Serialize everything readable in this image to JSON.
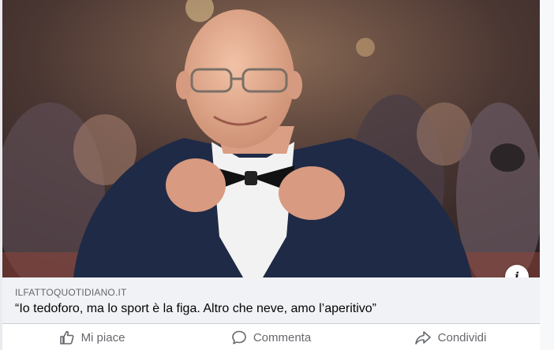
{
  "post": {
    "source_domain": "ILFATTOQUOTIDIANO.IT",
    "headline": "“Io tedoforo, ma lo sport è la figa. Altro che neve, amo l’aperitivo”",
    "info_icon_glyph": "i"
  },
  "actions": {
    "like_label": "Mi piace",
    "comment_label": "Commenta",
    "share_label": "Condividi"
  },
  "icons": {
    "like": "thumbs-up-icon",
    "comment": "speech-bubble-icon",
    "share": "share-arrow-icon",
    "info": "info-icon"
  },
  "colors": {
    "action_text": "#65676b",
    "meta_background": "#f0f2f5",
    "headline_text": "#050505"
  }
}
